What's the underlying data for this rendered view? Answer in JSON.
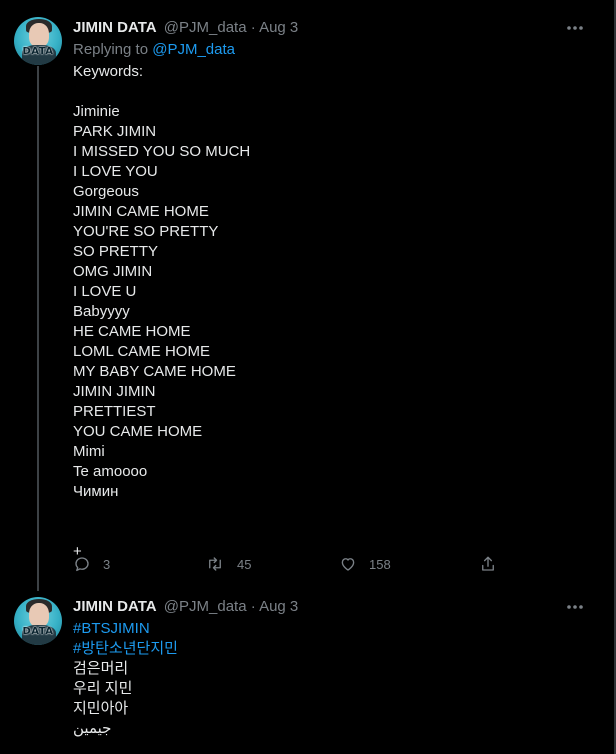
{
  "tweets": [
    {
      "author": {
        "name": "JIMIN DATA",
        "handle": "@PJM_data",
        "avatar_label": "DATA",
        "avatar_script": "jimin"
      },
      "date": "Aug 3",
      "separator": "·",
      "replying_to_prefix": "Replying to",
      "replying_to_handle": "@PJM_data",
      "lines": [
        "Keywords:",
        "",
        "Jiminie",
        "PARK JIMIN",
        "I MISSED YOU SO MUCH",
        "I LOVE YOU",
        "Gorgeous",
        "JIMIN CAME HOME",
        "YOU'RE SO PRETTY",
        "SO PRETTY",
        "OMG JIMIN",
        "I LOVE U",
        "Babyyyy",
        "HE CAME HOME",
        "LOML CAME HOME",
        "MY BABY CAME HOME",
        "JIMIN JIMIN",
        "PRETTIEST",
        "YOU CAME HOME",
        "Mimi",
        "Te amoooo",
        "Чимин",
        "",
        "",
        "+"
      ],
      "stats": {
        "replies": "3",
        "retweets": "45",
        "likes": "158"
      }
    },
    {
      "author": {
        "name": "JIMIN DATA",
        "handle": "@PJM_data",
        "avatar_label": "DATA",
        "avatar_script": "jimin"
      },
      "date": "Aug 3",
      "separator": "·",
      "hashtags": [
        "#BTSJIMIN",
        "#방탄소년단지민"
      ],
      "lines": [
        "검은머리",
        "우리 지민",
        "지민아아",
        "جيمين"
      ]
    }
  ],
  "icons": {
    "reply": "reply-icon",
    "retweet": "retweet-icon",
    "like": "heart-icon",
    "share": "share-icon",
    "more": "more-icon"
  },
  "colors": {
    "background": "#000000",
    "text": "#e7e9ea",
    "muted": "#7b8187",
    "link": "#1d9bf0",
    "thread_line": "#3d4246"
  }
}
